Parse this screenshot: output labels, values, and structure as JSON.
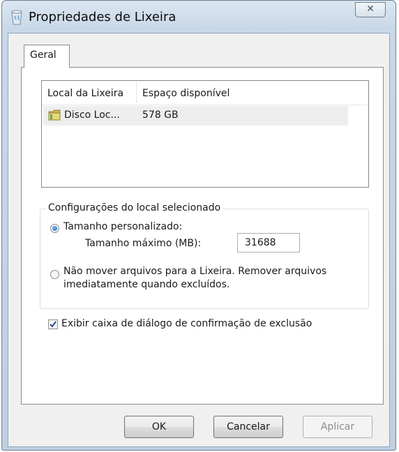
{
  "window": {
    "title": "Propriedades de Lixeira",
    "close_glyph": "✕"
  },
  "tabs": [
    {
      "label": "Geral"
    }
  ],
  "list": {
    "columns": [
      "Local da Lixeira",
      "Espaço disponível"
    ],
    "rows": [
      {
        "name": "Disco Loc...",
        "space": "578 GB",
        "icon": "folder-icon"
      }
    ]
  },
  "settings": {
    "group_title": "Configurações do local selecionado",
    "custom_size_label": "Tamanho personalizado:",
    "max_size_label": "Tamanho máximo (MB):",
    "max_size_value": "31688",
    "no_move_label": "Não mover arquivos para a Lixeira. Remover arquivos imediatamente quando excluídos.",
    "selected_option": "custom_size"
  },
  "confirm_checkbox": {
    "label": "Exibir caixa de diálogo de confirmação de exclusão",
    "checked": true
  },
  "buttons": {
    "ok": "OK",
    "cancel": "Cancelar",
    "apply": "Aplicar"
  },
  "colors": {
    "accent": "#1f5fb8",
    "frame": "#bfcfe0"
  }
}
